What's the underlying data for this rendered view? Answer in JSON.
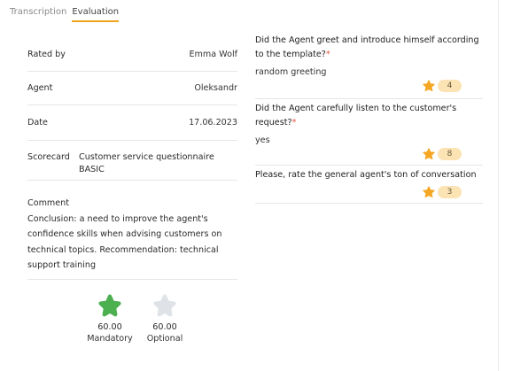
{
  "tabs": [
    {
      "label": "Transcription"
    },
    {
      "label": "Evaluation"
    }
  ],
  "info": {
    "rated_by_label": "Rated by",
    "rated_by_value": "Emma Wolf",
    "agent_label": "Agent",
    "agent_value": "Oleksandr",
    "date_label": "Date",
    "date_value": "17.06.2023",
    "scorecard_label": "Scorecard",
    "scorecard_value": "Customer service questionnaire BASIC",
    "comment_label": "Comment",
    "comment_text": "Conclusion: a need to improve the agent's confidence skills when advising customers on technical topics. Recommendation: technical support training"
  },
  "scores": [
    {
      "value": "60.00",
      "label": "Mandatory",
      "icon": "star-icon",
      "color": "#4caf50"
    },
    {
      "value": "60.00",
      "label": "Optional",
      "icon": "star-icon",
      "color": "#dfe3e8"
    }
  ],
  "questions": [
    {
      "text": "Did the Agent greet and introduce himself according to the template?",
      "required_mark": "*",
      "answer": "random greeting",
      "rating": "4"
    },
    {
      "text": "Did the Agent carefully listen to the customer's request?",
      "required_mark": "*",
      "answer": "yes",
      "rating": "8"
    },
    {
      "text": "Please, rate the general agent's ton of conversation",
      "required_mark": "",
      "answer": "",
      "rating": "3"
    }
  ],
  "colors": {
    "accent": "#f0a21a",
    "star_rating": "#f5a623",
    "pill_bg": "#fbe3b3",
    "required": "#e5533b",
    "mandatory_star": "#4caf50",
    "optional_star": "#dfe3e8"
  }
}
